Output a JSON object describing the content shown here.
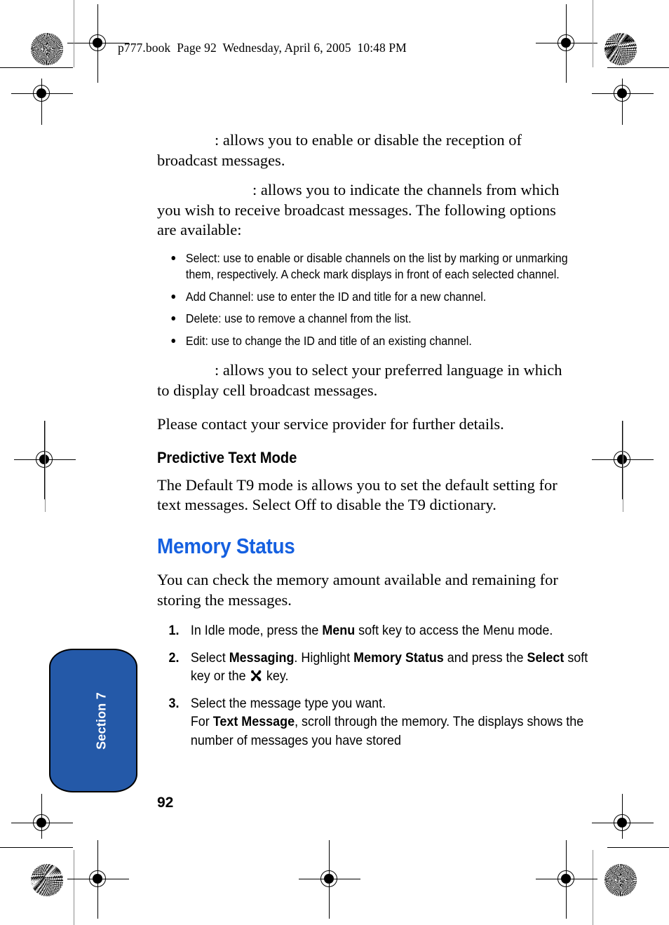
{
  "header": {
    "slug": "p777.book  Page 92  Wednesday, April 6, 2005  10:48 PM"
  },
  "content": {
    "paragraphs": [
      {
        "id": "cb-activation",
        "lead_gap": "medium",
        "text": ": allows you to enable or disable the reception of broadcast messages."
      },
      {
        "id": "cb-channels",
        "lead_gap": "large",
        "text": ": allows you to indicate the channels from which you wish to receive broadcast messages. The following options are available:"
      }
    ],
    "bullets": [
      "Select: use to enable or disable channels on the list by marking or unmarking them, respectively. A check mark displays in front of each selected channel.",
      "Add Channel: use to enter the ID and title for a new channel.",
      "Delete: use to remove a channel from the list.",
      "Edit: use to change the ID and title of an existing channel."
    ],
    "paragraphs_after": [
      {
        "id": "cb-language",
        "lead_gap": "small",
        "text": ": allows you to select your preferred language in which to display cell broadcast messages."
      },
      {
        "id": "contact-provider",
        "lead_gap": "none",
        "text": "Please contact your service provider for further details."
      }
    ],
    "subhead": "Predictive Text Mode",
    "subhead_body": "The Default T9 mode is allows you to set the default setting for text messages. Select Off to disable the T9 dictionary.",
    "chapter_heading": "Memory Status",
    "chapter_body": "You can check the memory amount available and remaining for storing the messages.",
    "steps": [
      {
        "number": "1.",
        "parts": [
          {
            "type": "text",
            "value": "In Idle mode, press the "
          },
          {
            "type": "bold",
            "value": "Menu"
          },
          {
            "type": "text",
            "value": " soft key to access the Menu mode."
          }
        ]
      },
      {
        "number": "2.",
        "parts": [
          {
            "type": "text",
            "value": "Select "
          },
          {
            "type": "bold",
            "value": "Messaging"
          },
          {
            "type": "text",
            "value": ". Highlight "
          },
          {
            "type": "bold",
            "value": "Memory Status"
          },
          {
            "type": "text",
            "value": " and press the "
          },
          {
            "type": "bold",
            "value": "Select"
          },
          {
            "type": "text",
            "value": " soft key or the "
          },
          {
            "type": "icon",
            "value": "ok-key-icon"
          },
          {
            "type": "text",
            "value": " key."
          }
        ]
      },
      {
        "number": "3.",
        "parts": [
          {
            "type": "text",
            "value": "Select the message type you want."
          },
          {
            "type": "break",
            "value": ""
          },
          {
            "type": "text",
            "value": "For "
          },
          {
            "type": "bold",
            "value": "Text Message"
          },
          {
            "type": "text",
            "value": ", scroll through the memory. The displays shows the number of messages you have stored"
          }
        ]
      }
    ]
  },
  "section_tab": {
    "label": "Section 7",
    "color": "#2459a8"
  },
  "folio": {
    "page_number": "92"
  },
  "colors": {
    "chapter_heading": "#1560e0",
    "tab_fill": "#2459a8",
    "text": "#000000"
  }
}
